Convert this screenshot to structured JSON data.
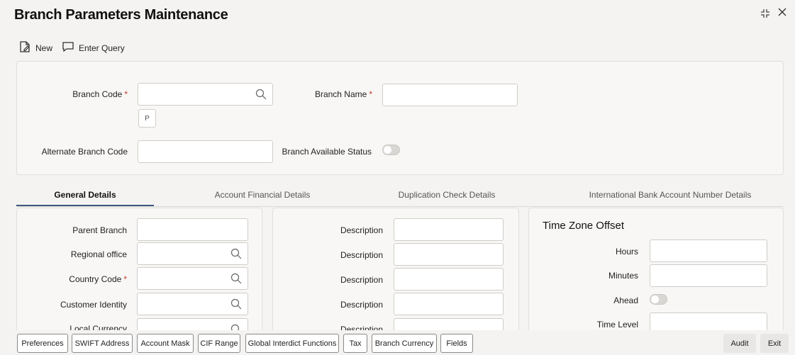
{
  "page": {
    "title": "Branch Parameters Maintenance"
  },
  "toolbar": {
    "new_label": "New",
    "enter_query_label": "Enter Query"
  },
  "header_form": {
    "branch_code_label": "Branch Code",
    "branch_name_label": "Branch Name",
    "p_button_label": "P",
    "alternate_branch_code_label": "Alternate Branch Code",
    "branch_available_status_label": "Branch Available Status",
    "required_marker": "*"
  },
  "tabs": [
    {
      "label": "General Details",
      "active": true
    },
    {
      "label": "Account Financial Details",
      "active": false
    },
    {
      "label": "Duplication Check Details",
      "active": false
    },
    {
      "label": "International Bank Account Number Details",
      "active": false
    }
  ],
  "general": {
    "fields": [
      {
        "label": "Parent Branch",
        "lookup": false,
        "required": false
      },
      {
        "label": "Regional office",
        "lookup": true,
        "required": false
      },
      {
        "label": "Country Code",
        "lookup": true,
        "required": true
      },
      {
        "label": "Customer Identity",
        "lookup": true,
        "required": false
      },
      {
        "label": "Local Currency",
        "lookup": true,
        "required": false
      }
    ],
    "descriptions": [
      "Description",
      "Description",
      "Description",
      "Description",
      "Description"
    ]
  },
  "time_zone": {
    "title": "Time Zone Offset",
    "hours_label": "Hours",
    "minutes_label": "Minutes",
    "ahead_label": "Ahead",
    "time_level_label": "Time Level"
  },
  "footer": {
    "buttons": [
      "Preferences",
      "SWIFT Address",
      "Account Mask",
      "CIF Range",
      "Global Interdict Functions",
      "Tax",
      "Branch Currency",
      "Fields"
    ],
    "audit_label": "Audit",
    "exit_label": "Exit"
  },
  "colors": {
    "accent": "#3d5a80",
    "required": "#c0392b",
    "background": "#f4f3f1"
  }
}
